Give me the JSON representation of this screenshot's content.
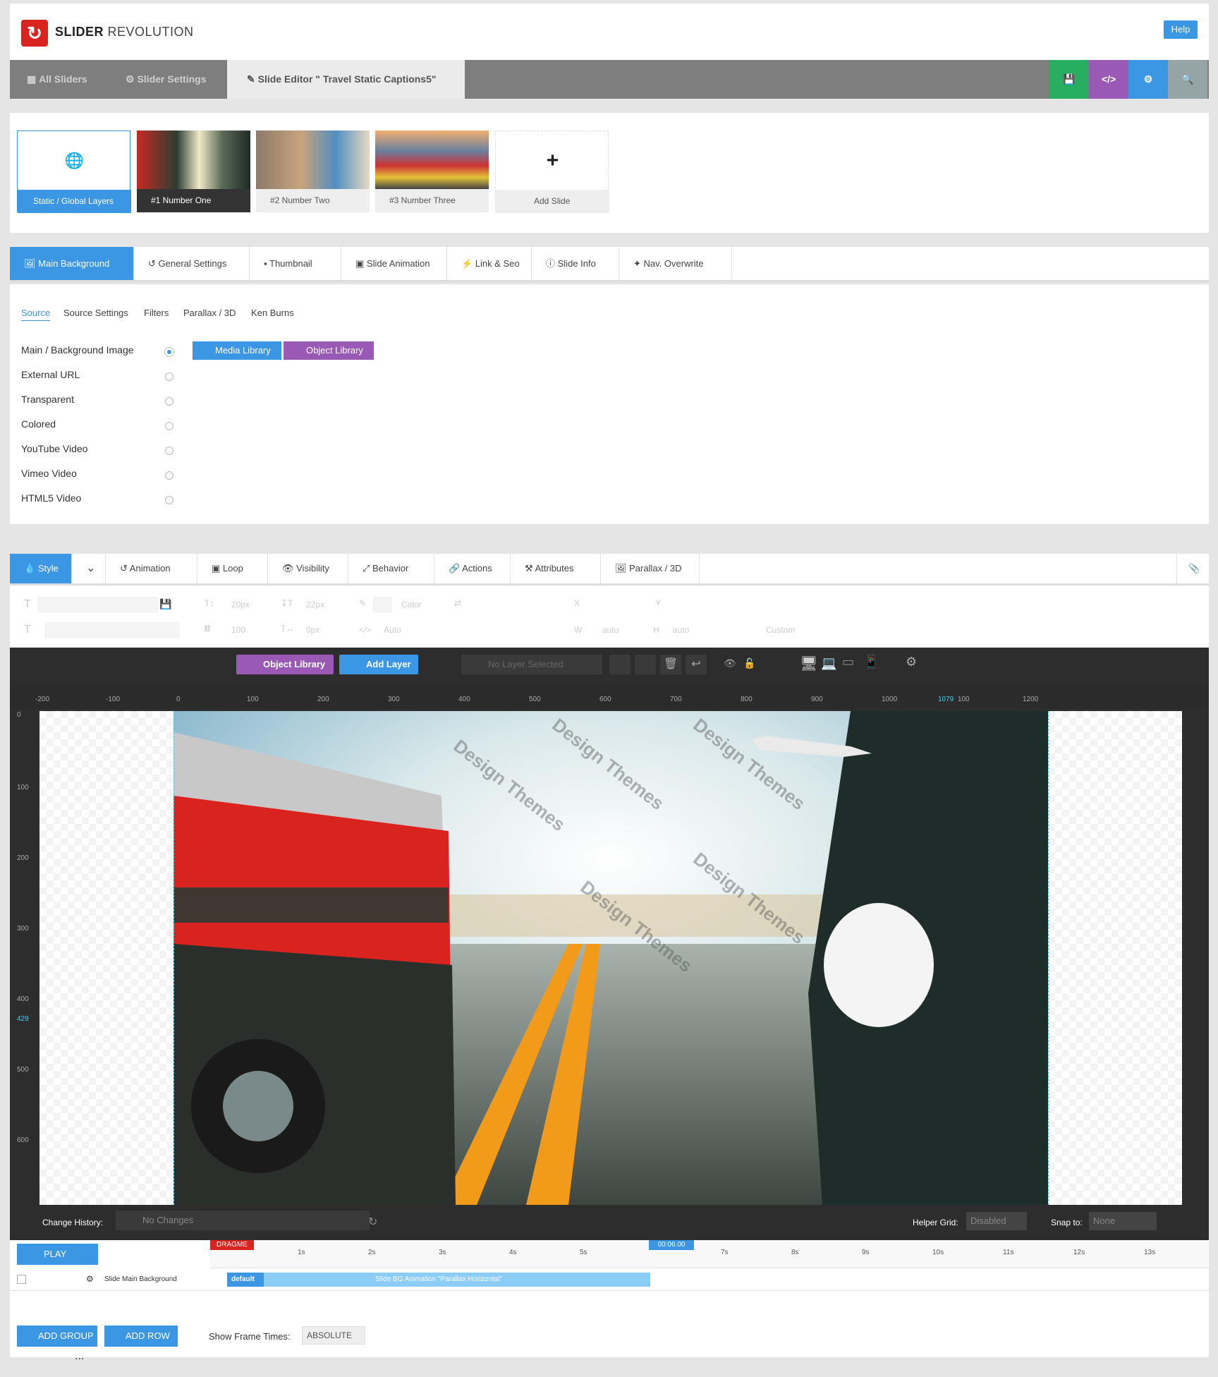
{
  "header": {
    "brand_bold": "SLIDER",
    "brand_light": " REVOLUTION",
    "help_label": "Help"
  },
  "topbar": {
    "all_sliders": "All Sliders",
    "slider_settings": "Slider Settings",
    "slide_editor": "Slide Editor \" Travel Static Captions5\""
  },
  "slides": [
    {
      "label": "Static / Global Layers"
    },
    {
      "label": "#1 Number One"
    },
    {
      "label": "#2 Number Two"
    },
    {
      "label": "#3 Number Three"
    },
    {
      "label": "Add Slide"
    }
  ],
  "bg_tabs": [
    "Main Background",
    "General Settings",
    "Thumbnail",
    "Slide Animation",
    "Link & Seo",
    "Slide Info",
    "Nav. Overwrite"
  ],
  "bg_subtabs": [
    "Source",
    "Source Settings",
    "Filters",
    "Parallax / 3D",
    "Ken Burns"
  ],
  "sources": [
    "Main / Background Image",
    "External URL",
    "Transparent",
    "Colored",
    "YouTube Video",
    "Vimeo Video",
    "HTML5 Video"
  ],
  "library_buttons": {
    "media": "Media Library",
    "object": "Object Library"
  },
  "layer_tabs": [
    "Style",
    "Animation",
    "Loop",
    "Visibility",
    "Behavior",
    "Actions",
    "Attributes",
    "Parallax / 3D"
  ],
  "props": {
    "font_size": "20px",
    "line_height": "22px",
    "color": "Color",
    "x": "X",
    "y": "Y",
    "weight": "100",
    "letter": "0px",
    "auto": "Auto",
    "w": "W",
    "h": "H",
    "w_val": "auto",
    "h_val": "auto",
    "custom": "Custom"
  },
  "editor": {
    "object_library": "Object Library",
    "add_layer": "Add Layer",
    "no_layer": "No Layer Selected"
  },
  "ruler_top": [
    "-200",
    "-100",
    "0",
    "100",
    "200",
    "300",
    "400",
    "500",
    "600",
    "700",
    "800",
    "900",
    "1000",
    "1079",
    "100",
    "1200"
  ],
  "ruler_left": [
    "0",
    "100",
    "200",
    "300",
    "400",
    "429",
    "500",
    "600",
    "700"
  ],
  "watermark": "Design Themes",
  "history": {
    "label": "Change History:",
    "value": "No Changes",
    "helper_label": "Helper Grid:",
    "helper_value": "Disabled",
    "snap_label": "Snap to:",
    "snap_value": "None"
  },
  "timeline": {
    "play": "PLAY",
    "dragme": "DRAGME",
    "marker": "00:06.00",
    "ticks": [
      "1s",
      "2s",
      "3s",
      "4s",
      "5s",
      "7s",
      "8s",
      "9s",
      "10s",
      "11s",
      "12s",
      "13s"
    ],
    "row_label": "Slide Main Background",
    "default": "default",
    "bar_text": "Slide BG Animation  \"Parallax Horizontal\""
  },
  "bottom": {
    "add_group": "ADD GROUP",
    "add_row": "ADD ROW",
    "frame_label": "Show Frame Times:",
    "frame_value": "ABSOLUTE",
    "dots": "..."
  },
  "colors": {
    "accent": "#3b97e3",
    "brand_red": "#d9231f",
    "save_green": "#27ae60",
    "code_purple": "#9b59b6",
    "topbar_gray": "#7e7e7e"
  }
}
